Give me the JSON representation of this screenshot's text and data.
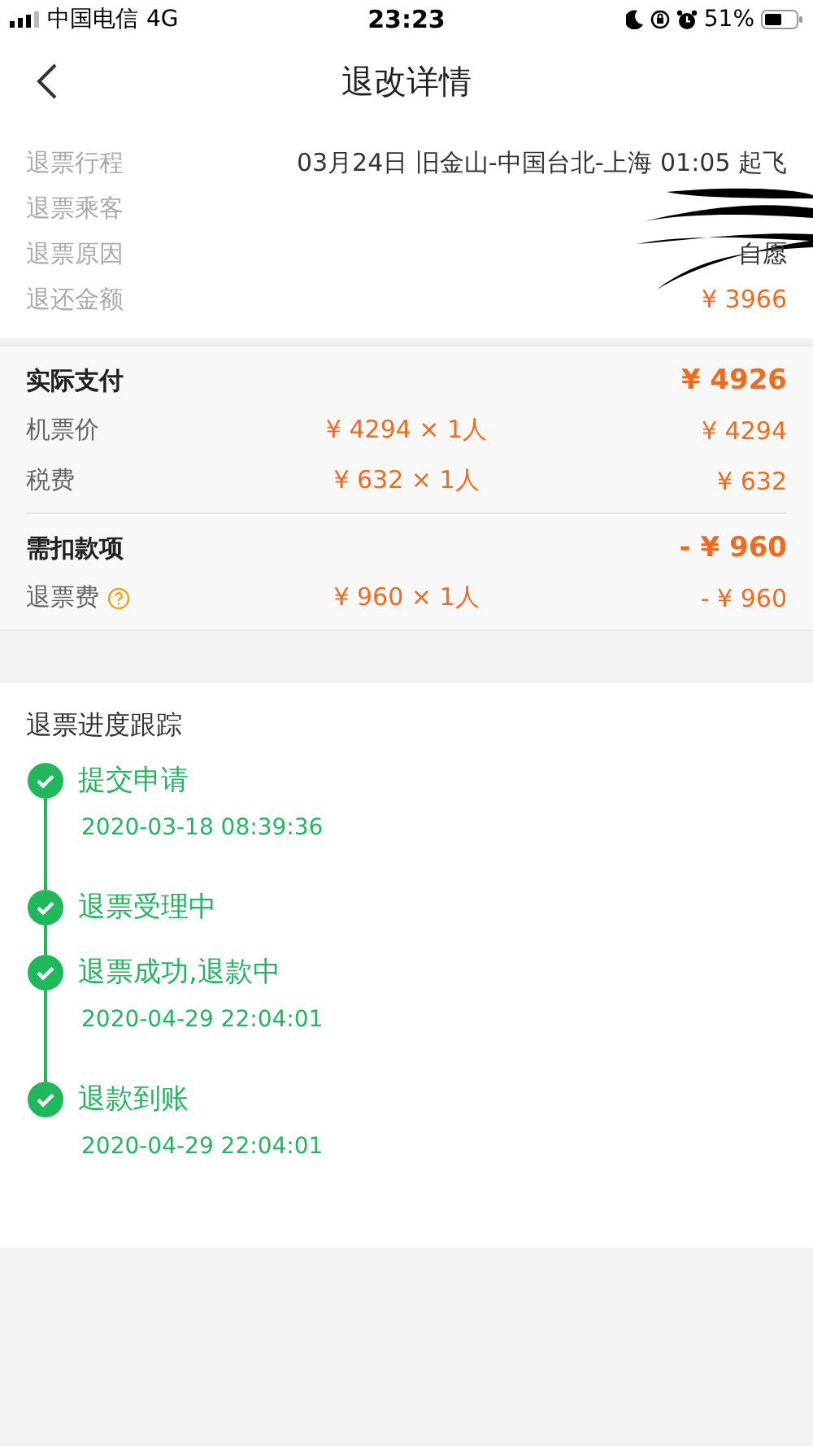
{
  "status_bar": {
    "carrier": "中国电信",
    "network": "4G",
    "time": "23:23",
    "battery": "51%"
  },
  "nav": {
    "title": "退改详情"
  },
  "info_rows": [
    {
      "label": "退票行程",
      "value": "03月24日 旧金山-中国台北-上海 01:05 起飞",
      "kind": "plain"
    },
    {
      "label": "退票乘客",
      "kind": "redacted"
    },
    {
      "label": "退票原因",
      "value": "自愿",
      "kind": "plain"
    },
    {
      "label": "退还金额",
      "value": "¥ 3966",
      "kind": "amount"
    }
  ],
  "price_groups": [
    {
      "title": "实际支付",
      "total": "¥ 4926",
      "rows": [
        {
          "label": "机票价",
          "unit": "¥ 4294 × 1人",
          "amount": "¥ 4294",
          "help": false
        },
        {
          "label": "税费",
          "unit": "¥ 632 × 1人",
          "amount": "¥ 632",
          "help": false
        }
      ]
    },
    {
      "title": "需扣款项",
      "total": "- ¥ 960",
      "rows": [
        {
          "label": "退票费",
          "unit": "¥ 960 × 1人",
          "amount": "- ¥ 960",
          "help": true
        }
      ]
    }
  ],
  "progress": {
    "title": "退票进度跟踪",
    "steps": [
      {
        "label": "提交申请",
        "time": "2020-03-18 08:39:36",
        "done": true
      },
      {
        "label": "退票受理中",
        "done": true
      },
      {
        "label": "退票成功,退款中",
        "time": "2020-04-29 22:04:01",
        "done": true
      },
      {
        "label": "退款到账",
        "time": "2020-04-29 22:04:01",
        "done": true
      }
    ]
  }
}
